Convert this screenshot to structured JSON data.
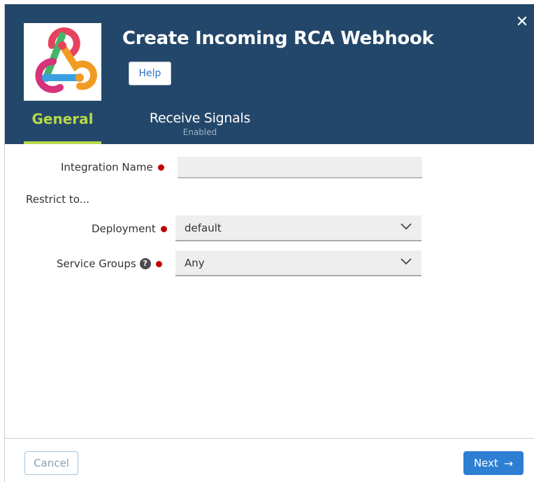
{
  "dialog": {
    "title": "Create Incoming RCA Webhook",
    "help_label": "Help",
    "close_glyph": "✕",
    "logo_icon": "webhook-icon"
  },
  "tabs": [
    {
      "label": "General",
      "active": true
    },
    {
      "label": "Receive Signals",
      "sublabel": "Enabled",
      "active": false
    }
  ],
  "form": {
    "integration_name": {
      "label": "Integration Name",
      "value": "",
      "required": true
    },
    "restrict_label": "Restrict to...",
    "deployment": {
      "label": "Deployment",
      "value": "default",
      "required": true
    },
    "service_groups": {
      "label": "Service Groups",
      "value": "Any",
      "required": true,
      "help_icon": "question-circle-icon"
    }
  },
  "footer": {
    "cancel_label": "Cancel",
    "next_label": "Next",
    "next_arrow": "→"
  },
  "colors": {
    "header_bg": "#23476a",
    "active_tab": "#b8d94a",
    "primary": "#2d7fd3",
    "required": "#c00000"
  }
}
